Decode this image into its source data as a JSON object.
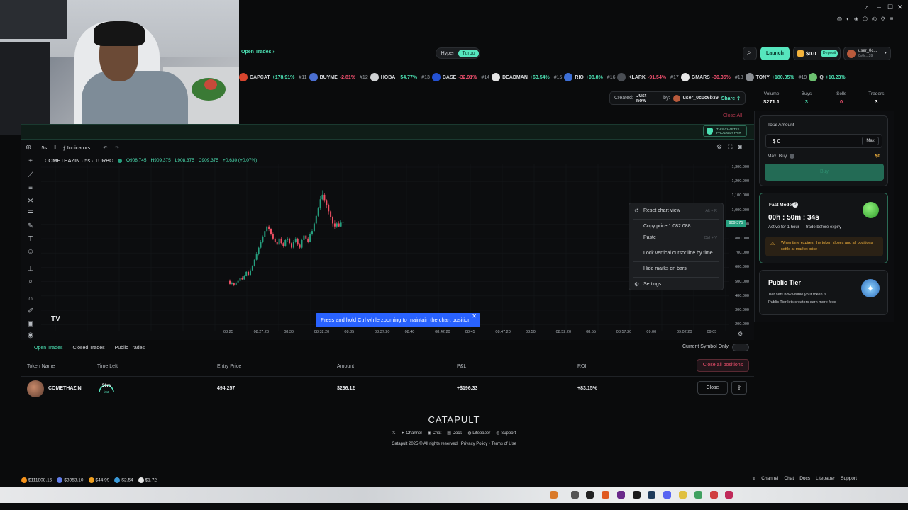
{
  "nav": {
    "open_trades": "Open Trades ›",
    "hyper": "Hyper",
    "turbo": "Turbo",
    "launch": "Launch",
    "wallet_balance": "$0.0",
    "wallet_action": "Deposit",
    "profile_name": "user_0c...",
    "profile_sub": "0x0c...39"
  },
  "ticker": [
    {
      "rank": "",
      "name": "CAPCAT",
      "change": "+178.91%",
      "dir": "pos",
      "color": "#d8452e"
    },
    {
      "rank": "#11",
      "name": "BUYME",
      "change": "-2.81%",
      "dir": "neg",
      "color": "#4b6fd1"
    },
    {
      "rank": "#12",
      "name": "HOBA",
      "change": "+54.77%",
      "dir": "pos",
      "color": "#d0d2d4"
    },
    {
      "rank": "#13",
      "name": "BASE",
      "change": "-32.91%",
      "dir": "neg",
      "color": "#2451d3"
    },
    {
      "rank": "#14",
      "name": "DEADMAN",
      "change": "+63.54%",
      "dir": "pos",
      "color": "#e4e4e4"
    },
    {
      "rank": "#15",
      "name": "RIO",
      "change": "+98.8%",
      "dir": "pos",
      "color": "#3d6fd6"
    },
    {
      "rank": "#16",
      "name": "KLARK",
      "change": "-91.54%",
      "dir": "neg",
      "color": "#4a4e54"
    },
    {
      "rank": "#17",
      "name": "GMARS",
      "change": "-30.35%",
      "dir": "neg",
      "color": "#e8e8e8"
    },
    {
      "rank": "#18",
      "name": "TONY",
      "change": "+180.05%",
      "dir": "pos",
      "color": "#8a8e93"
    },
    {
      "rank": "#19",
      "name": "Q",
      "change": "+10.23%",
      "dir": "pos",
      "color": "#6cc070"
    }
  ],
  "info": {
    "created_label": "Created:",
    "created_value": "Just now",
    "by_label": "by:",
    "by_value": "user_0c0c6b39",
    "share": "Share",
    "close_all_top": "Close All",
    "fair_badge": "THIS CHART IS PROVABLY FAIR"
  },
  "stats": [
    {
      "label": "Volume",
      "value": "$271.1",
      "tone": "white"
    },
    {
      "label": "Buys",
      "value": "3",
      "tone": "pos"
    },
    {
      "label": "Sells",
      "value": "0",
      "tone": "neg"
    },
    {
      "label": "Traders",
      "value": "3",
      "tone": "white"
    }
  ],
  "chart_toolbar": {
    "interval": "5s",
    "indicators": "Indicators"
  },
  "symbol_line": {
    "symbol": "COMETHAZIN · 5s · TURBO",
    "o": "O908.745",
    "h": "H909.375",
    "l": "L908.375",
    "c": "C909.375",
    "chg": "+0.630 (+0.07%)"
  },
  "chart_data": {
    "type": "candlestick",
    "y_ticks": [
      "1,300.000",
      "1,200.000",
      "1,100.000",
      "1,000.000",
      "900.000",
      "800.000",
      "700.000",
      "600.000",
      "500.000",
      "400.000",
      "300.000",
      "200.000"
    ],
    "x_ticks": [
      "08:25",
      "08:27:20",
      "08:30",
      "08:32:20",
      "08:35",
      "08:37:20",
      "08:40",
      "08:42:20",
      "08:45",
      "08:47:20",
      "08:50",
      "08:52:20",
      "08:55",
      "08:57:20",
      "09:00",
      "09:02:20",
      "09:05"
    ],
    "last_price": "909.375",
    "ylim": [
      200,
      1300
    ],
    "candles": [
      [
        520,
        500,
        530,
        495
      ],
      [
        500,
        505,
        515,
        495
      ],
      [
        505,
        490,
        510,
        485
      ],
      [
        490,
        510,
        520,
        488
      ],
      [
        510,
        520,
        525,
        505
      ],
      [
        520,
        540,
        545,
        515
      ],
      [
        540,
        530,
        550,
        525
      ],
      [
        530,
        555,
        560,
        528
      ],
      [
        555,
        580,
        585,
        550
      ],
      [
        580,
        560,
        590,
        555
      ],
      [
        560,
        590,
        600,
        555
      ],
      [
        590,
        620,
        625,
        585
      ],
      [
        620,
        660,
        665,
        615
      ],
      [
        660,
        700,
        710,
        655
      ],
      [
        700,
        740,
        745,
        690
      ],
      [
        740,
        780,
        790,
        735
      ],
      [
        780,
        810,
        820,
        770
      ],
      [
        810,
        850,
        860,
        800
      ],
      [
        850,
        880,
        885,
        840
      ],
      [
        880,
        860,
        890,
        850
      ],
      [
        860,
        830,
        870,
        820
      ],
      [
        830,
        800,
        840,
        790
      ],
      [
        800,
        780,
        810,
        770
      ],
      [
        780,
        760,
        790,
        750
      ],
      [
        760,
        800,
        805,
        755
      ],
      [
        800,
        770,
        810,
        760
      ],
      [
        770,
        750,
        780,
        740
      ],
      [
        750,
        790,
        795,
        745
      ],
      [
        790,
        800,
        810,
        780
      ],
      [
        800,
        770,
        805,
        760
      ],
      [
        770,
        740,
        780,
        730
      ],
      [
        740,
        780,
        790,
        735
      ],
      [
        780,
        800,
        810,
        770
      ],
      [
        800,
        760,
        805,
        750
      ],
      [
        760,
        740,
        770,
        730
      ],
      [
        740,
        790,
        800,
        735
      ],
      [
        790,
        820,
        830,
        780
      ],
      [
        820,
        800,
        830,
        790
      ],
      [
        800,
        780,
        810,
        770
      ],
      [
        780,
        830,
        840,
        775
      ],
      [
        830,
        850,
        860,
        820
      ],
      [
        850,
        900,
        910,
        845
      ],
      [
        900,
        950,
        960,
        895
      ],
      [
        950,
        1000,
        1010,
        940
      ],
      [
        1000,
        1060,
        1080,
        990
      ],
      [
        1060,
        1090,
        1120,
        1050
      ],
      [
        1090,
        1050,
        1100,
        1040
      ],
      [
        1050,
        1020,
        1060,
        1000
      ],
      [
        1020,
        980,
        1030,
        960
      ],
      [
        980,
        940,
        990,
        920
      ],
      [
        940,
        900,
        950,
        880
      ],
      [
        900,
        880,
        920,
        860
      ],
      [
        880,
        900,
        910,
        870
      ],
      [
        900,
        880,
        915,
        875
      ],
      [
        880,
        905,
        920,
        875
      ],
      [
        905,
        909,
        915,
        900
      ]
    ]
  },
  "context_menu": {
    "reset": "Reset chart view",
    "reset_sc": "Alt + R",
    "copy": "Copy price 1,082.088",
    "paste": "Paste",
    "paste_sc": "Ctrl + V",
    "lock": "Lock vertical cursor line by time",
    "hide": "Hide marks on bars",
    "settings": "Settings..."
  },
  "toast": "Press and hold Ctrl while zooming to maintain the chart position",
  "trades": {
    "tabs": [
      "Open Trades",
      "Closed Trades",
      "Public Trades"
    ],
    "current_symbol": "Current Symbol Only",
    "headers": [
      "Token Name",
      "Time Left",
      "Entry Price",
      "Amount",
      "P&L",
      "ROI"
    ],
    "close_all": "Close all positions",
    "row": {
      "name": "COMETHAZIN",
      "time_left": "50m",
      "time_sub": "fast",
      "entry": "494.257",
      "amount": "$236.12",
      "pnl": "+$196.33",
      "roi": "+83.15%",
      "close": "Close"
    }
  },
  "right": {
    "total_amount": "Total Amount",
    "amount_value": "$ 0",
    "max": "Max",
    "max_buy": "Max. Buy",
    "max_buy_value": "$0",
    "buy_btn": "Buy",
    "fast_title": "Fast Mode",
    "fast_timer": "00h : 50m : 34s",
    "fast_sub": "Active for 1 hour — trade before expiry",
    "fast_warn": "When time expires, the token closes and all positions settle at market price",
    "tier_title": "Public Tier",
    "tier_desc": "Tier sets how visible your token is\nPublic Tier lets creators earn more fees"
  },
  "footer": {
    "logo": "CATAPULT",
    "links": [
      "Channel",
      "Chat",
      "Docs",
      "Litepaper",
      "Support"
    ],
    "copy": "Catapult 2025 © All rights reserved",
    "privacy": "Privacy Policy",
    "terms": "Terms of Use"
  },
  "status": {
    "coins": [
      {
        "value": "$111808.15",
        "color": "#f7931a"
      },
      {
        "value": "$3953.10",
        "color": "#627eea"
      },
      {
        "value": "$44.99",
        "color": "#f0a020"
      },
      {
        "value": "$2.54",
        "color": "#3a9ad9"
      },
      {
        "value": "$1.72",
        "color": "#e6e6e6"
      }
    ],
    "links": [
      "Channel",
      "Chat",
      "Docs",
      "Litepaper",
      "Support"
    ]
  },
  "colors": {
    "accent": "#56e6be",
    "positive": "#4ce0b3",
    "negative": "#f0506e"
  }
}
